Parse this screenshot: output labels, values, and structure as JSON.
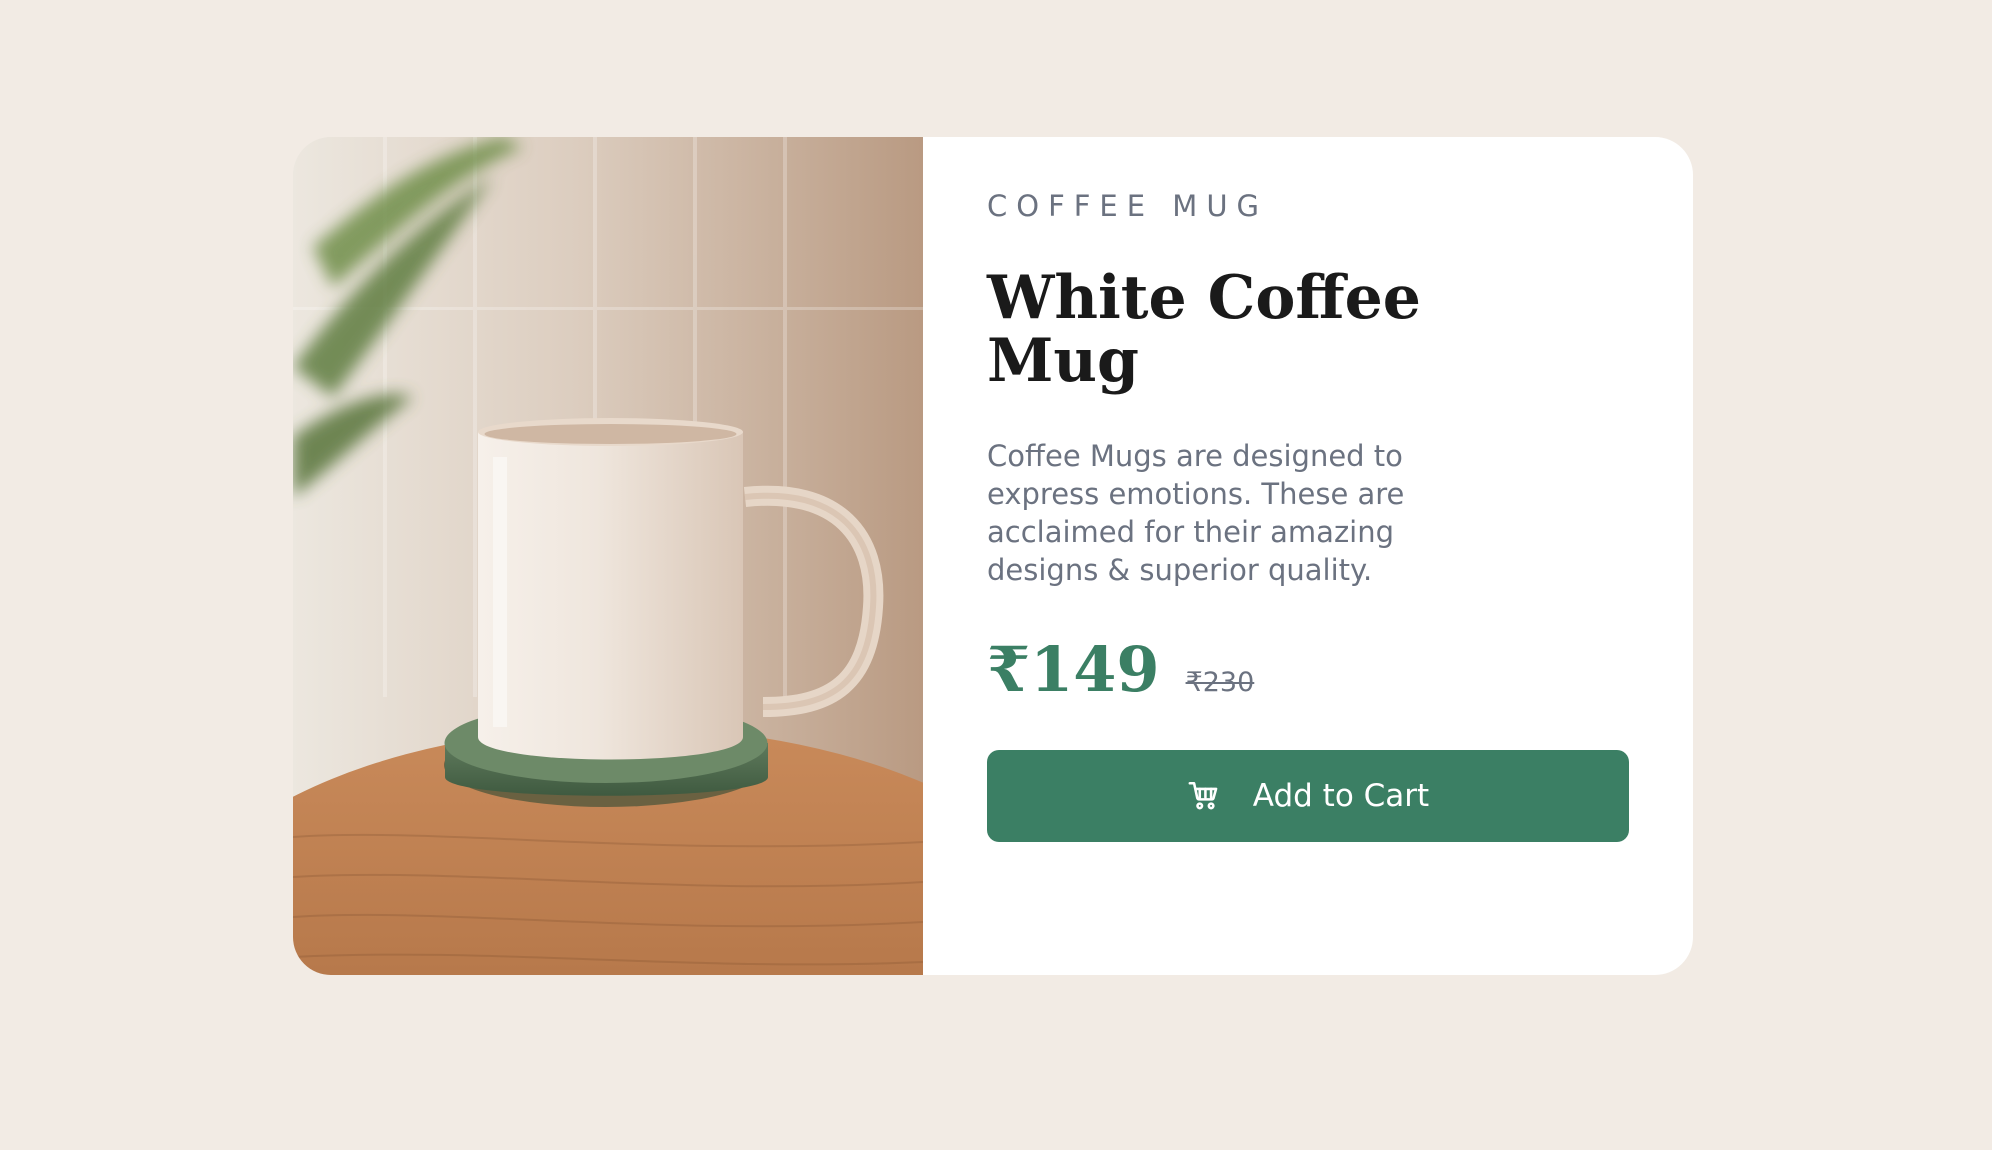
{
  "product": {
    "image_alt": "White coffee mug on a green marble coaster on a wooden table",
    "category": "COFFEE MUG",
    "title": "White Coffee Mug",
    "description": "Coffee Mugs are designed to express emotions. These are acclaimed for their amazing designs & superior quality.",
    "price": "₹149",
    "original_price": "₹230",
    "add_to_cart_label": "Add to Cart",
    "cart_icon": "cart-icon"
  },
  "colors": {
    "background": "#f2ebe4",
    "card": "#ffffff",
    "accent": "#3b7f64",
    "muted_text": "#6b7280",
    "title_text": "#1a1a1a"
  }
}
